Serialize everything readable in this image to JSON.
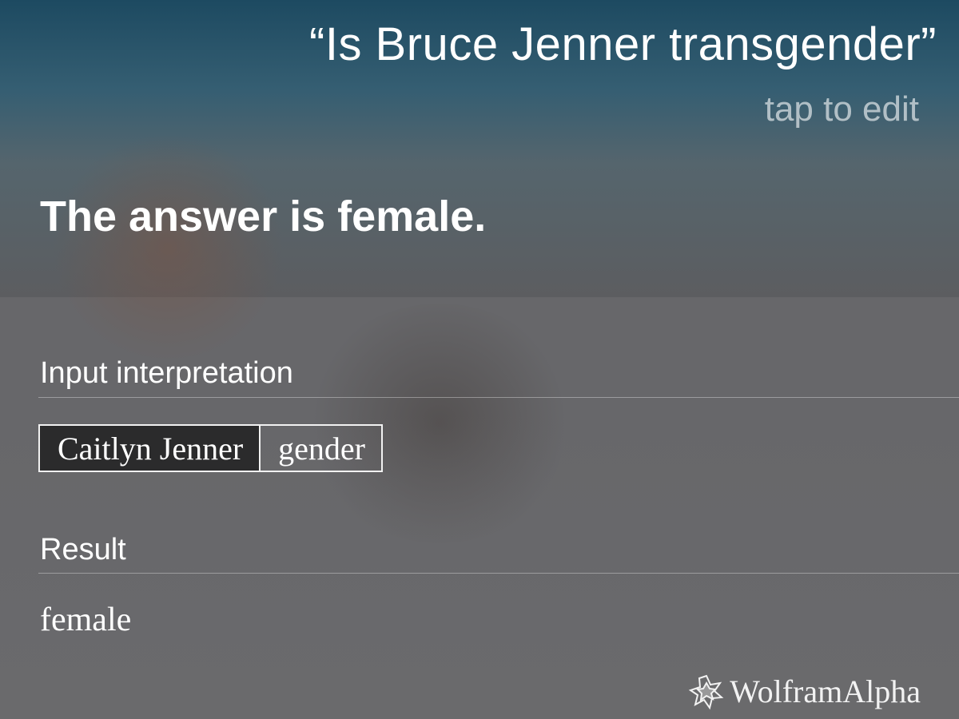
{
  "siri": {
    "query": "“Is Bruce Jenner transgender”",
    "tap_to_edit": "tap to edit",
    "answer": "The answer is female."
  },
  "wolfram": {
    "input_interpretation_heading": "Input interpretation",
    "interpretation": {
      "entity": "Caitlyn Jenner",
      "property": "gender"
    },
    "result_heading": "Result",
    "result_value": "female",
    "brand": "WolframAlpha",
    "brand_icon": "wolfram-spikey-icon"
  }
}
